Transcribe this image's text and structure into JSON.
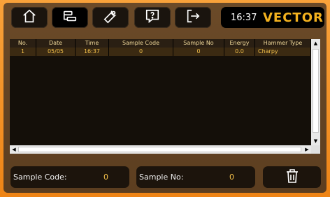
{
  "topbar": {
    "buttons": [
      {
        "name": "home",
        "icon": "home-icon"
      },
      {
        "name": "list",
        "icon": "list-icon"
      },
      {
        "name": "settings",
        "icon": "wrench-icon"
      },
      {
        "name": "help",
        "icon": "help-icon"
      },
      {
        "name": "logout",
        "icon": "logout-icon"
      }
    ],
    "time": "16:37",
    "brand": "VECTOR"
  },
  "table": {
    "columns": [
      "No.",
      "Date",
      "Time",
      "Sample Code",
      "Sample No",
      "Energy",
      "Hammer Type"
    ],
    "rows": [
      [
        "1",
        "05/05",
        "16:37",
        "0",
        "0",
        "0.0",
        "Charpy"
      ]
    ]
  },
  "footer": {
    "sample_code_label": "Sample Code:",
    "sample_code_value": "0",
    "sample_no_label": "Sample No:",
    "sample_no_value": "0",
    "delete_icon": "trash-icon"
  },
  "colors": {
    "accent": "#f3b21f",
    "frame": "#f08a1e",
    "panel": "#5c3e20"
  }
}
